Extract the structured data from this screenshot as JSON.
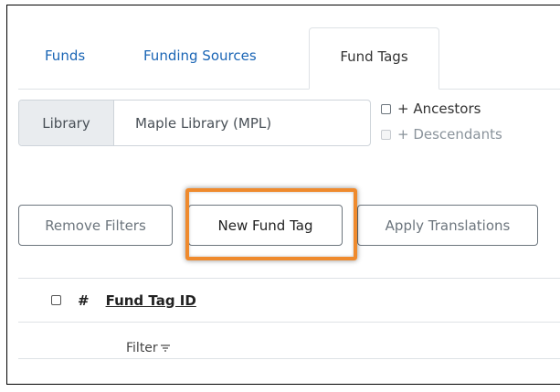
{
  "tabs": [
    {
      "label": "Funds",
      "active": false
    },
    {
      "label": "Funding Sources",
      "active": false
    },
    {
      "label": "Fund Tags",
      "active": true
    }
  ],
  "library": {
    "label": "Library",
    "value": "Maple Library (MPL)",
    "ancestors_label": "+ Ancestors",
    "descendants_label": "+ Descendants"
  },
  "buttons": {
    "remove_filters": "Remove Filters",
    "new_fund_tag": "New Fund Tag",
    "apply_translations": "Apply Translations"
  },
  "table": {
    "hash": "#",
    "column_fund_tag_id": "Fund Tag ID",
    "filter_label": "Filter",
    "filter_icon": "filter-icon"
  },
  "colors": {
    "link": "#1a65b5",
    "highlight": "#ef8a2d"
  }
}
